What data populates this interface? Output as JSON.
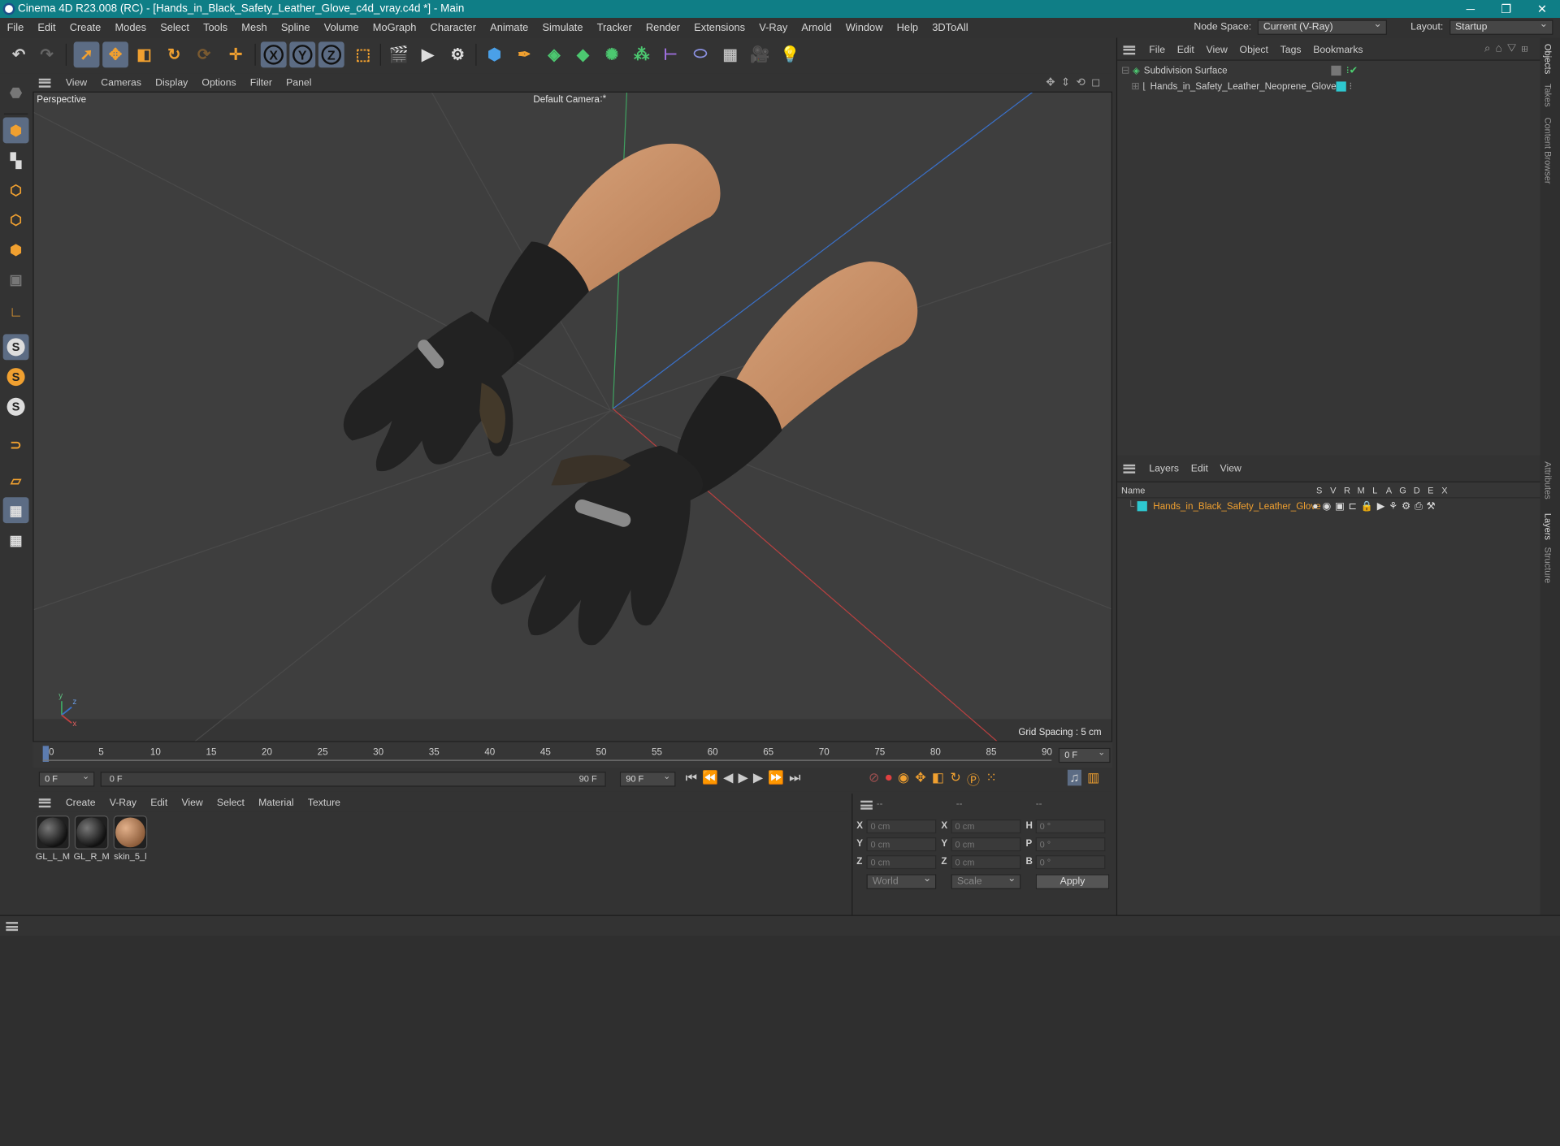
{
  "titlebar": {
    "title": "Cinema 4D R23.008 (RC) - [Hands_in_Black_Safety_Leather_Glove_c4d_vray.c4d *] - Main",
    "minimize": "─",
    "restore": "❐",
    "close": "✕"
  },
  "menubar": {
    "items": [
      "File",
      "Edit",
      "Create",
      "Modes",
      "Select",
      "Tools",
      "Mesh",
      "Spline",
      "Volume",
      "MoGraph",
      "Character",
      "Animate",
      "Simulate",
      "Tracker",
      "Render",
      "Extensions",
      "V-Ray",
      "Arnold",
      "Window",
      "Help",
      "3DToAll"
    ],
    "node_space_label": "Node Space:",
    "node_space_value": "Current (V-Ray)",
    "layout_label": "Layout:",
    "layout_value": "Startup"
  },
  "toolbar": {
    "x_label": "X",
    "y_label": "Y",
    "z_label": "Z"
  },
  "viewport": {
    "menu": [
      "View",
      "Cameras",
      "Display",
      "Options",
      "Filter",
      "Panel"
    ],
    "view_name": "Perspective",
    "camera": "Default Camera",
    "camera_suffix": ":*",
    "grid_spacing": "Grid Spacing : 5 cm",
    "axis_y": "y",
    "axis_z": "z",
    "axis_x": "x"
  },
  "timeline": {
    "ticks": [
      "0",
      "5",
      "10",
      "15",
      "20",
      "25",
      "30",
      "35",
      "40",
      "45",
      "50",
      "55",
      "60",
      "65",
      "70",
      "75",
      "80",
      "85",
      "90"
    ],
    "current_frame": "0 F",
    "start_field": "0 F",
    "range_start": "0 F",
    "range_end": "90 F",
    "end_field": "90 F"
  },
  "materials": {
    "menu": [
      "Create",
      "V-Ray",
      "Edit",
      "View",
      "Select",
      "Material",
      "Texture"
    ],
    "items": [
      {
        "name": "GL_L_M"
      },
      {
        "name": "GL_R_M"
      },
      {
        "name": "skin_5_l"
      }
    ]
  },
  "coords": {
    "header": [
      "--",
      "--",
      "--"
    ],
    "rows": [
      {
        "a": "X",
        "av": "0 cm",
        "b": "X",
        "bv": "0 cm",
        "c": "H",
        "cv": "0 °"
      },
      {
        "a": "Y",
        "av": "0 cm",
        "b": "Y",
        "bv": "0 cm",
        "c": "P",
        "cv": "0 °"
      },
      {
        "a": "Z",
        "av": "0 cm",
        "b": "Z",
        "bv": "0 cm",
        "c": "B",
        "cv": "0 °"
      }
    ],
    "world": "World",
    "scale": "Scale",
    "apply": "Apply"
  },
  "objects": {
    "menu": [
      "File",
      "Edit",
      "View",
      "Object",
      "Tags",
      "Bookmarks"
    ],
    "rows": [
      {
        "name": "Subdivision Surface"
      },
      {
        "name": "Hands_in_Safety_Leather_Neoprene_Gloves"
      }
    ]
  },
  "layers": {
    "menu": [
      "Layers",
      "Edit",
      "View"
    ],
    "name_header": "Name",
    "flags": [
      "S",
      "V",
      "R",
      "M",
      "L",
      "A",
      "G",
      "D",
      "E",
      "X"
    ],
    "rows": [
      {
        "name": "Hands_in_Black_Safety_Leather_Glove"
      }
    ]
  },
  "side_tabs": [
    "Objects",
    "Takes",
    "Content Browser",
    "Attributes",
    "Layers",
    "Structure"
  ],
  "colors": {
    "titlebar": "#0f7e86",
    "accent_orange": "#f0a030",
    "selected_tool": "#5c6c84",
    "layer_color": "#2ec8d0"
  }
}
